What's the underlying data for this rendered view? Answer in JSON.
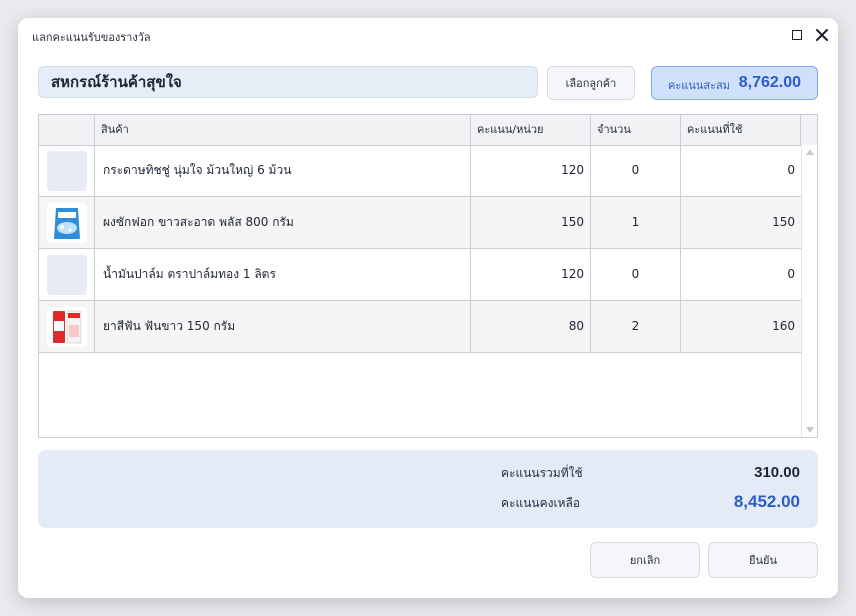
{
  "window": {
    "title": "แลกคะแนนรับของรางวัล"
  },
  "customer": {
    "name": "สหกรณ์ร้านค้าสุขใจ",
    "select_label": "เลือกลูกค้า"
  },
  "points": {
    "label": "คะแนนสะสม",
    "value": "8,762.00",
    "accent": "#2c5cc4"
  },
  "table": {
    "columns": [
      "สินค้า",
      "คะแนน/หน่วย",
      "จำนวน",
      "คะแนนที่ใช้"
    ],
    "rows": [
      {
        "name": "กระดาษทิชชู่ นุ่มใจ ม้วนใหญ่ 6 ม้วน",
        "points_per_unit": "120",
        "qty": "0",
        "used": "0",
        "image": "none"
      },
      {
        "name": "ผงซักฟอก ขาวสะอาด พลัส 800 กรัม",
        "points_per_unit": "150",
        "qty": "1",
        "used": "150",
        "image": "detergent-bag"
      },
      {
        "name": "น้ำมันปาล์ม ตราปาล์มทอง 1 ลิตร",
        "points_per_unit": "120",
        "qty": "0",
        "used": "0",
        "image": "none"
      },
      {
        "name": "ยาสีฟัน ฟันขาว 150 กรัม",
        "points_per_unit": "80",
        "qty": "2",
        "used": "160",
        "image": "toothpaste-box"
      }
    ]
  },
  "summary": {
    "used_label": "คะแนนรวมที่ใช้",
    "used_value": "310.00",
    "remaining_label": "คะแนนคงเหลือ",
    "remaining_value": "8,452.00",
    "remaining_color": "#2c5cc4"
  },
  "actions": {
    "cancel_label": "ยกเลิก",
    "confirm_label": "ยืนยัน"
  }
}
